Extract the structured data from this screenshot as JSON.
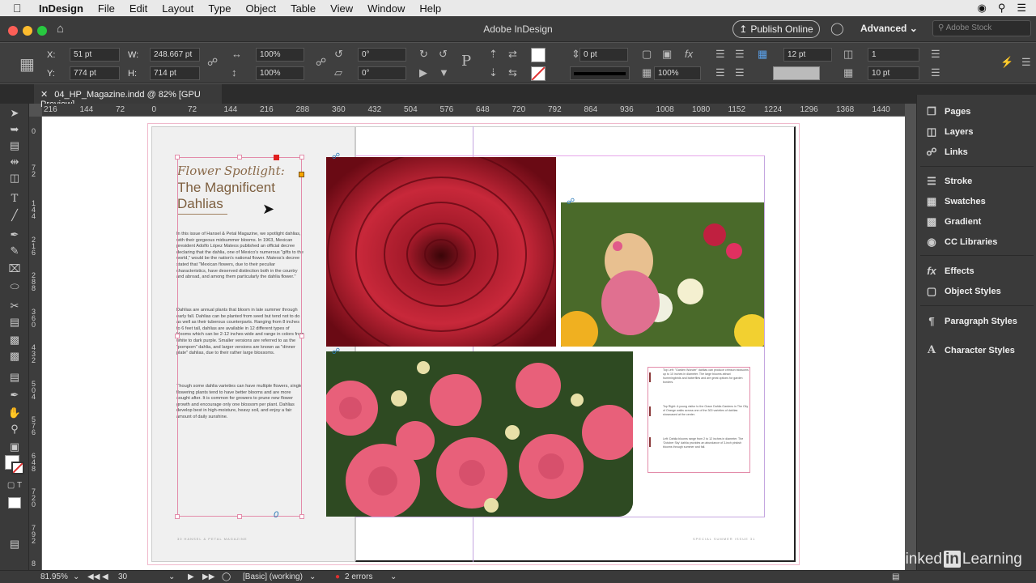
{
  "menubar": {
    "app_name": "InDesign",
    "items": [
      "File",
      "Edit",
      "Layout",
      "Type",
      "Object",
      "Table",
      "View",
      "Window",
      "Help"
    ]
  },
  "titlebar": {
    "title": "Adobe InDesign",
    "publish_label": "Publish Online",
    "workspace_label": "Advanced",
    "stock_placeholder": "Adobe Stock"
  },
  "control": {
    "x_label": "X:",
    "x_value": "51 pt",
    "y_label": "Y:",
    "y_value": "774 pt",
    "w_label": "W:",
    "w_value": "248.667 pt",
    "h_label": "H:",
    "h_value": "714 pt",
    "scale_x": "100%",
    "scale_y": "100%",
    "rotate": "0°",
    "shear": "0°",
    "stroke_weight": "0 pt",
    "opacity": "100%",
    "gutter": "12 pt",
    "columns": "1",
    "inset": "10 pt"
  },
  "document_tab": "04_HP_Magazine.indd @ 82% [GPU Preview]",
  "ruler_ticks": [
    "216",
    "144",
    "72",
    "0",
    "72",
    "144",
    "216",
    "288",
    "360",
    "432",
    "504",
    "576",
    "648",
    "720",
    "792",
    "864",
    "936",
    "1008",
    "1080",
    "1152",
    "1224",
    "1296",
    "1368",
    "1440"
  ],
  "vruler_ticks": [
    "0",
    "7 2",
    "1 4 4",
    "2 1 6",
    "2 8 8",
    "3 6 0",
    "4 3 2",
    "5 0 4",
    "5 7 6",
    "6 4 8",
    "7 2 0",
    "7 9 2",
    "8"
  ],
  "article": {
    "headline1": "Flower Spotlight:",
    "headline2": "The Magnificent Dahlias",
    "para1": "In this issue of Hansel & Petal Magazine, we spotlight dahlias, with their gorgeous midsummer blooms. In 1963, Mexican president Adolfo López Mateos published an official decree declaring that the dahlia, one of Mexico's numerous \"gifts to the world,\" would be the nation's national flower. Mateos's decree stated that \"Mexican flowers, due to their peculiar characteristics, have deserved distinction both in the country and abroad, and among them particularly the dahlia flower.\"",
    "para2": "Dahlias are annual plants that bloom in late summer through early fall. Dahlias can be planted from seed but tend not to do as well as their tuberous counterparts. Ranging from 8 inches to 6 feet tall, dahlias are available in 12 different types of blooms which can be 2-12 inches wide and range in colors from white to dark purple. Smaller versions are referred to as the \"pompom\" dahlia, and larger versions are known as \"dinner plate\" dahlias, due to their rather large blossoms.",
    "para3": "Though some dahlia varieties can have multiple flowers, single flowering plants tend to have better blooms and are more sought after. It is common for growers to prune new flower growth and encourage only one blossom per plant. Dahlias develop best in high-moisture, heavy soil, and enjoy a fair amount of daily sunshine.",
    "overset_marker": "0"
  },
  "captions": [
    "Top Left: \"Garden Wonder\" dahlias can produce crimson blossoms up to 10 inches in diameter. The large blooms attract hummingbirds and butterflies and are great options for garden borders.",
    "Top Right: A young visitor to the Grace Dahlia Gardens in The City of Orange walks across one of the 300 varieties of dahlias showcased at the center.",
    "Left: Dahlia blooms range from 2 to 12 inches in diameter. The 'October Sky' dahlia provides an abundance of 3-inch pinkish blooms through summer and fall."
  ],
  "folios": {
    "left": "30   HANSEL & PETAL MAGAZINE",
    "right": "SPECIAL SUMMER ISSUE   31"
  },
  "panels": [
    {
      "label": "Pages",
      "icon": "pages-icon"
    },
    {
      "label": "Layers",
      "icon": "layers-icon"
    },
    {
      "label": "Links",
      "icon": "links-icon"
    },
    {
      "label": "Stroke",
      "icon": "stroke-icon"
    },
    {
      "label": "Swatches",
      "icon": "swatches-icon"
    },
    {
      "label": "Gradient",
      "icon": "gradient-icon"
    },
    {
      "label": "CC Libraries",
      "icon": "cc-libraries-icon"
    },
    {
      "label": "Effects",
      "icon": "effects-icon"
    },
    {
      "label": "Object Styles",
      "icon": "object-styles-icon"
    },
    {
      "label": "Paragraph Styles",
      "icon": "paragraph-styles-icon"
    },
    {
      "label": "Character Styles",
      "icon": "character-styles-icon"
    }
  ],
  "status": {
    "zoom": "81.95%",
    "page": "30",
    "profile": "[Basic] (working)",
    "errors": "2 errors"
  },
  "watermark": {
    "pre": "Linked",
    "in": "in",
    "post": "Learning"
  },
  "colors": {
    "error": "#e03030",
    "frame": "#e38caa",
    "accent": "#8a6a4a"
  }
}
